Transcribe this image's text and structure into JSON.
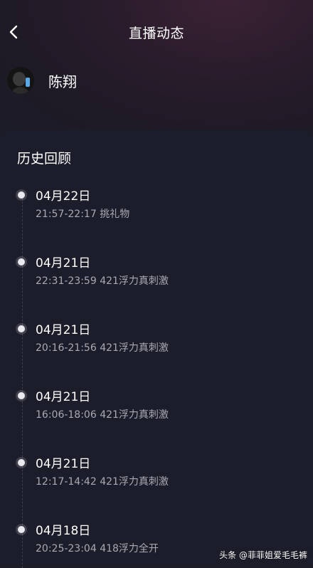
{
  "header": {
    "back_icon": "chevron-left-icon",
    "title": "直播动态"
  },
  "profile": {
    "avatar_icon": "user-avatar",
    "name": "陈翔"
  },
  "history": {
    "title": "历史回顾",
    "entries": [
      {
        "date": "04月22日",
        "detail": "21:57-22:17 挑礼物"
      },
      {
        "date": "04月21日",
        "detail": "22:31-23:59 421浮力真刺激"
      },
      {
        "date": "04月21日",
        "detail": "20:16-21:56 421浮力真刺激"
      },
      {
        "date": "04月21日",
        "detail": "16:06-18:06 421浮力真刺激"
      },
      {
        "date": "04月21日",
        "detail": "12:17-14:42 421浮力真刺激"
      },
      {
        "date": "04月18日",
        "detail": "20:25-23:04 418浮力全开"
      }
    ]
  },
  "watermark": "头条 @菲菲姐爱毛毛裤",
  "colors": {
    "background": "#1b1c28",
    "header_glow": "#3b2235",
    "text_primary": "#ffffff",
    "text_secondary": "#a8a9b5"
  }
}
